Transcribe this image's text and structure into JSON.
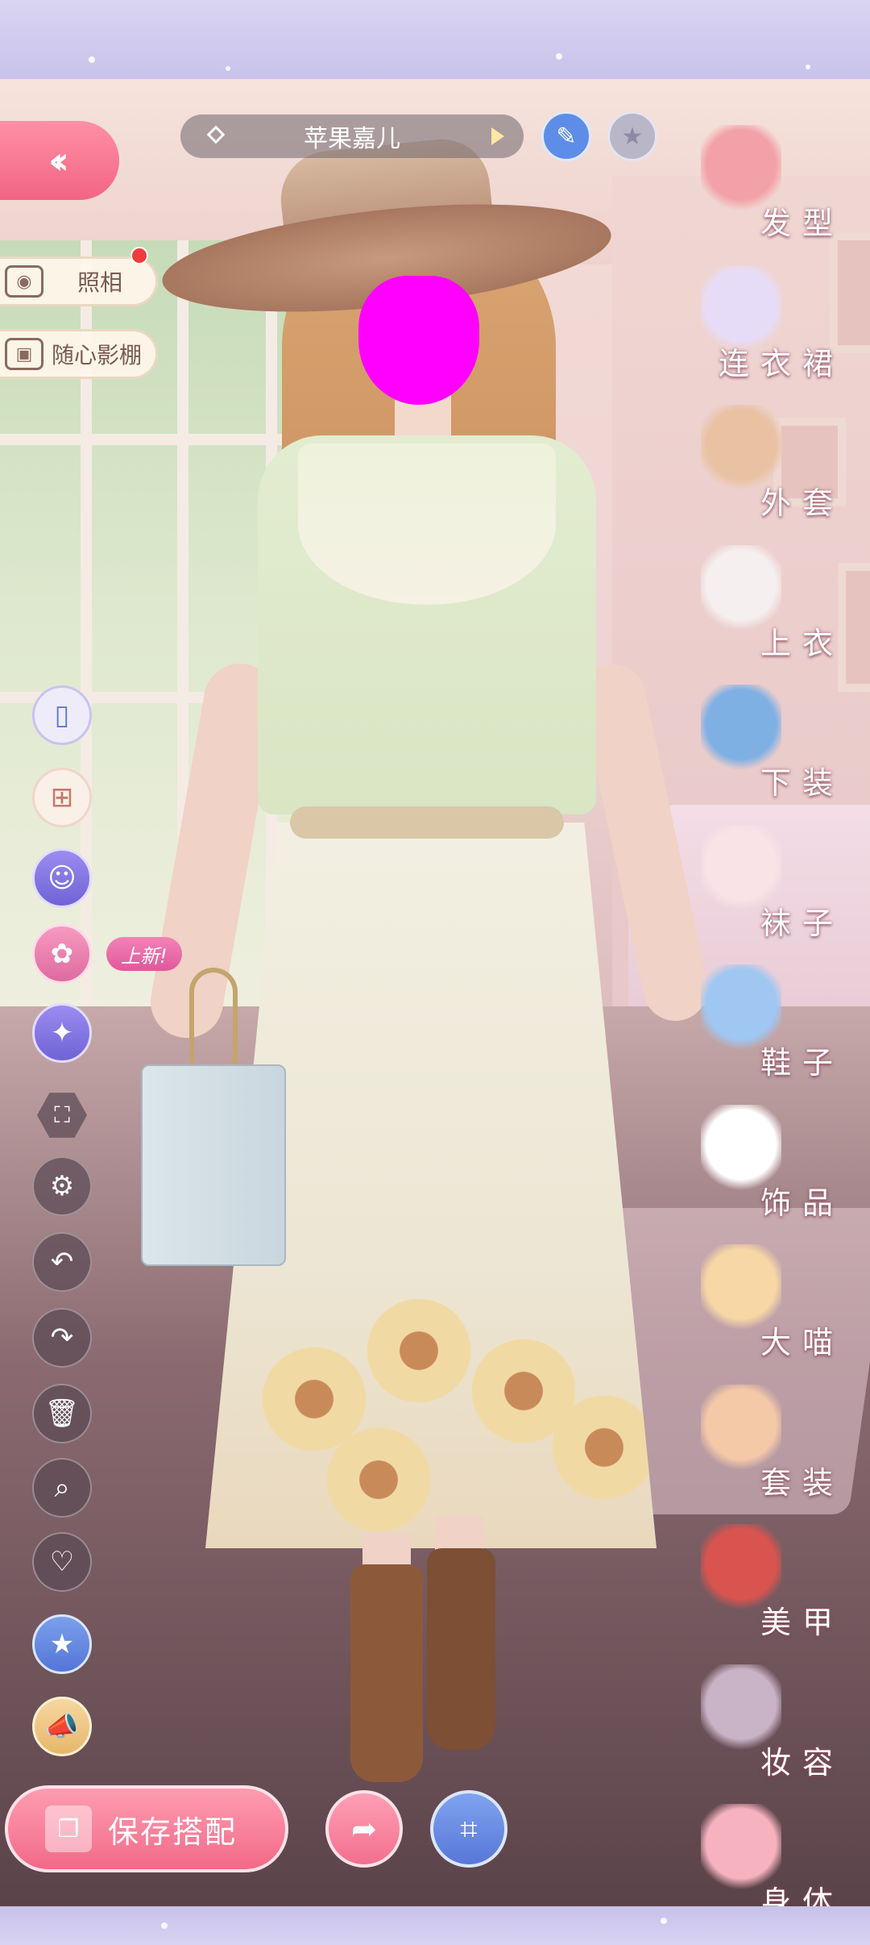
{
  "character": {
    "name": "苹果嘉儿"
  },
  "left_menu": {
    "photo_label": "照相",
    "studio_label": "随心影棚",
    "new_badge": "上新!"
  },
  "bottom_bar": {
    "save_label": "保存搭配"
  },
  "categories": [
    {
      "label": "发型",
      "icon": "hairstyle-icon",
      "color": "#f3a1a8"
    },
    {
      "label": "连衣裙",
      "icon": "dress-icon",
      "color": "#e7dcf8"
    },
    {
      "label": "外套",
      "icon": "coat-icon",
      "color": "#e8c2a3"
    },
    {
      "label": "上衣",
      "icon": "top-icon",
      "color": "#f5efef"
    },
    {
      "label": "下装",
      "icon": "bottoms-icon",
      "color": "#7fb0e4"
    },
    {
      "label": "袜子",
      "icon": "socks-icon",
      "color": "#f9e3e6"
    },
    {
      "label": "鞋子",
      "icon": "shoes-icon",
      "color": "#9fc7f2"
    },
    {
      "label": "饰品",
      "icon": "tiara-icon",
      "color": "#ffffff"
    },
    {
      "label": "大喵",
      "icon": "cat-icon",
      "color": "#f7d7a6"
    },
    {
      "label": "套装",
      "icon": "outfit-set-icon",
      "color": "#f4c9a8"
    },
    {
      "label": "美甲",
      "icon": "nail-polish-icon",
      "color": "#d9544f"
    },
    {
      "label": "妆容",
      "icon": "makeup-icon",
      "color": "#c9b3c7"
    },
    {
      "label": "身体",
      "icon": "body-icon",
      "color": "#f6b2bf"
    }
  ],
  "colors": {
    "accent_pink": "#f26a88",
    "accent_blue": "#5877d8",
    "band_lavender": "#c9c2eb"
  }
}
